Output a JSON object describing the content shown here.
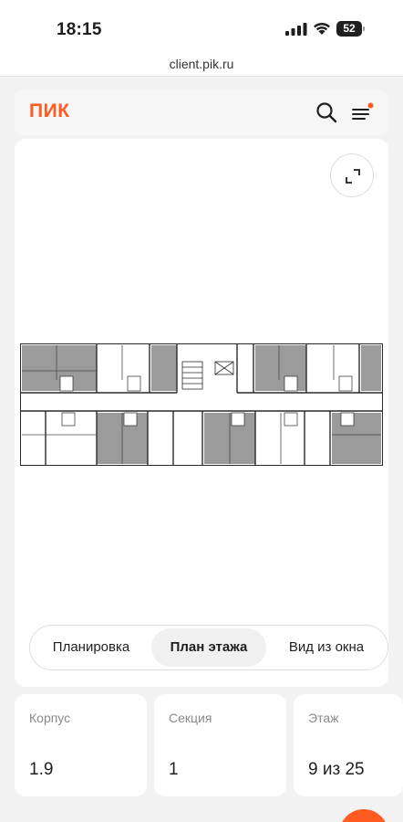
{
  "status_bar": {
    "time": "18:15",
    "battery": "52"
  },
  "browser": {
    "url": "client.pik.ru"
  },
  "header": {
    "logo": "ПИК"
  },
  "view_tabs": [
    {
      "label": "Планировка",
      "active": false
    },
    {
      "label": "План этажа",
      "active": true
    },
    {
      "label": "Вид из окна",
      "active": false
    }
  ],
  "info_cards": [
    {
      "label": "Корпус",
      "value": "1.9"
    },
    {
      "label": "Секция",
      "value": "1"
    },
    {
      "label": "Этаж",
      "value": "9 из 25"
    }
  ],
  "colors": {
    "accent": "#ff5a1f",
    "sold_unit": "#9b9b9b"
  }
}
